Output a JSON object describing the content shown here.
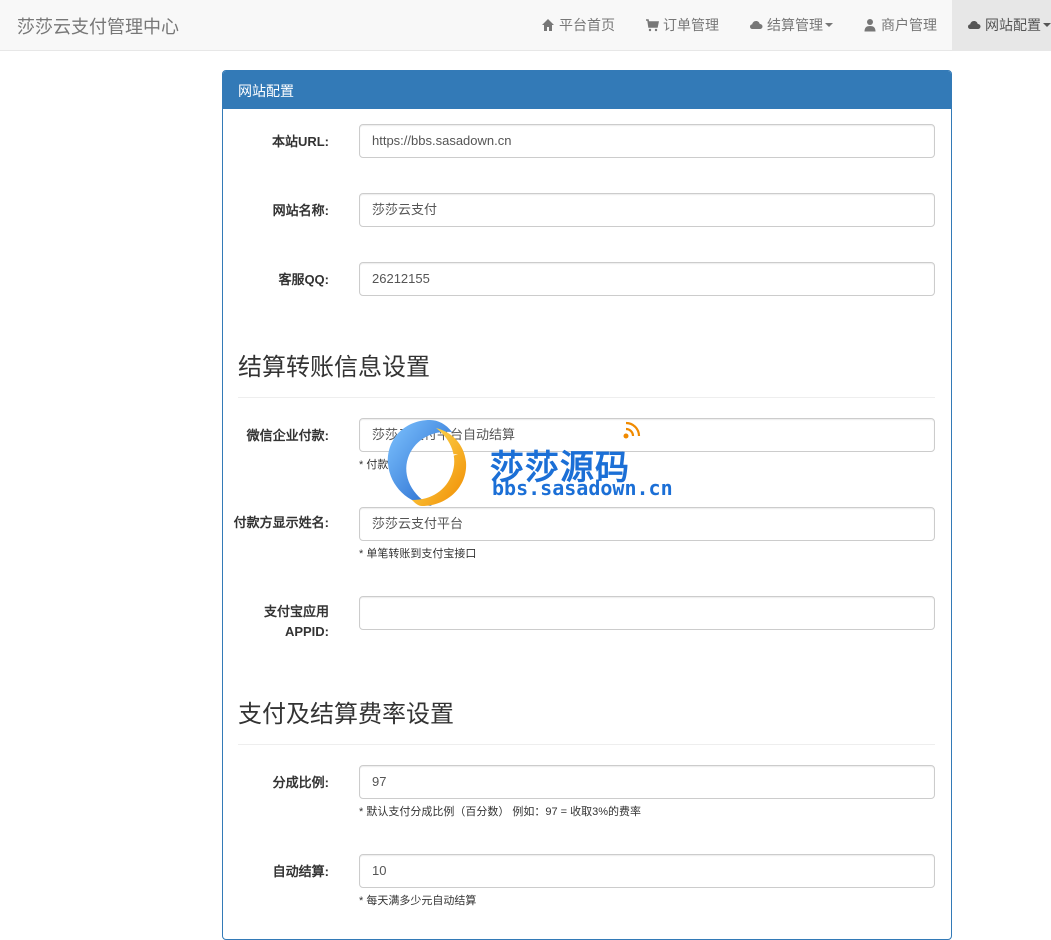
{
  "brand": "莎莎云支付管理中心",
  "nav": [
    {
      "label": "平台首页",
      "icon": "home-icon"
    },
    {
      "label": "订单管理",
      "icon": "cart-icon"
    },
    {
      "label": "结算管理",
      "icon": "cloud-icon"
    },
    {
      "label": "商户管理",
      "icon": "user-icon"
    },
    {
      "label": "网站配置",
      "icon": "cloud-icon"
    }
  ],
  "panel": {
    "title": "网站配置"
  },
  "fields": {
    "site_url": {
      "label": "本站URL:",
      "value": "https://bbs.sasadown.cn"
    },
    "site_name": {
      "label": "网站名称:",
      "value": "莎莎云支付"
    },
    "service_qq": {
      "label": "客服QQ:",
      "value": "26212155"
    },
    "wechat_pay": {
      "label": "微信企业付款:",
      "value": "莎莎云支付平台自动结算",
      "help": "* 付款"
    },
    "payer_name": {
      "label": "付款方显示姓名:",
      "value": "莎莎云支付平台",
      "help": "* 单笔转账到支付宝接口"
    },
    "alipay_appid": {
      "label": "支付宝应用APPID:",
      "value": ""
    },
    "split_ratio": {
      "label": "分成比例:",
      "value": "97",
      "help": "* 默认支付分成比例（百分数） 例如：97 = 收取3%的费率"
    },
    "auto_settle": {
      "label": "自动结算:",
      "value": "10",
      "help": "* 每天满多少元自动结算"
    }
  },
  "sections": {
    "transfer": "结算转账信息设置",
    "rates": "支付及结算费率设置"
  },
  "watermark": {
    "cn": "莎莎源码",
    "en": "bbs.sasadown.cn"
  }
}
